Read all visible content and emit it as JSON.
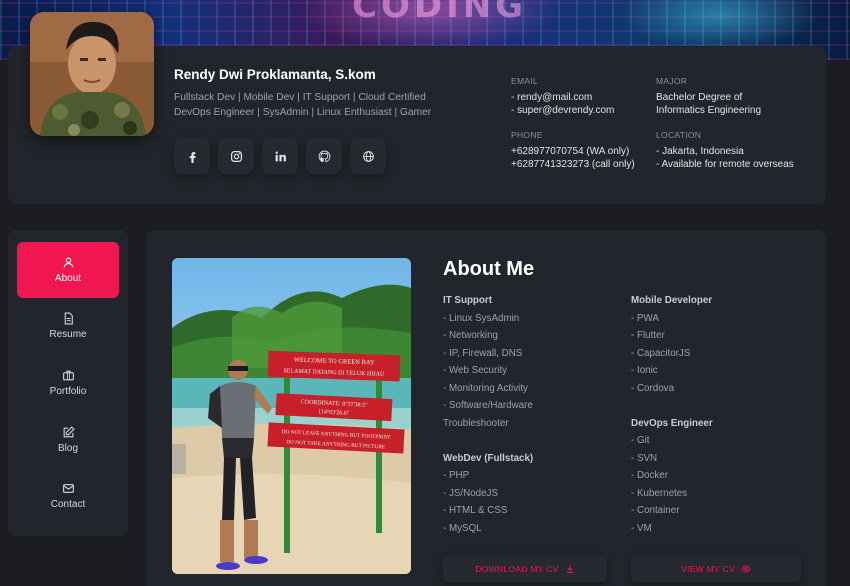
{
  "banner": {
    "text": "CODING"
  },
  "profile": {
    "name": "Rendy Dwi Proklamanta, S.kom",
    "roles_line1": "Fullstack Dev | Mobile Dev | IT Support | Cloud Certified",
    "roles_line2": "DevOps Engineer | SysAdmin | Linux Enthusiast | Gamer"
  },
  "socials": [
    {
      "name": "facebook-icon"
    },
    {
      "name": "instagram-icon"
    },
    {
      "name": "linkedin-icon"
    },
    {
      "name": "github-icon"
    },
    {
      "name": "globe-icon"
    }
  ],
  "info": {
    "email_label": "EMAIL",
    "email_1": "- rendy@mail.com",
    "email_2": "- super@devrendy.com",
    "major_label": "MAJOR",
    "major_1": "Bachelor Degree of",
    "major_2": "Informatics Engineering",
    "phone_label": "PHONE",
    "phone_1": "+628977070754 (WA only)",
    "phone_2": "+6287741323273 (call only)",
    "location_label": "LOCATION",
    "location_1": "- Jakarta, Indonesia",
    "location_2": "- Available for remote overseas"
  },
  "nav": [
    {
      "label": "About",
      "icon": "user-icon"
    },
    {
      "label": "Resume",
      "icon": "document-icon"
    },
    {
      "label": "Portfolio",
      "icon": "briefcase-icon"
    },
    {
      "label": "Blog",
      "icon": "edit-icon"
    },
    {
      "label": "Contact",
      "icon": "mail-icon"
    }
  ],
  "about": {
    "title": "About Me",
    "it_support": {
      "heading": "IT Support",
      "items": [
        "- Linux SysAdmin",
        "- Networking",
        "- IP, Firewall, DNS",
        "- Web Security",
        "- Monitoring Activity",
        "- Software/Hardware",
        "Troubleshooter"
      ]
    },
    "webdev": {
      "heading": "WebDev (Fullstack)",
      "items": [
        "- PHP",
        "- JS/NodeJS",
        "- HTML & CSS",
        "- MySQL"
      ]
    },
    "mobile": {
      "heading": "Mobile Developer",
      "items": [
        "- PWA",
        "- Flutter",
        "- CapacitorJS",
        "- Ionic",
        "- Cordova"
      ]
    },
    "devops": {
      "heading": "DevOps Engineer",
      "items": [
        "- Git",
        "- SVN",
        "- Docker",
        "- Kubernetes",
        "- Container",
        "- VM"
      ]
    },
    "download_cv": "DOWNLOAD MY CV",
    "view_cv": "VIEW MY CV"
  },
  "photo_signs": {
    "sign1_line1": "WELCOME TO GREEN BAY",
    "sign1_line2": "SELAMAT DATANG DI TELUK HIJAU",
    "sign2_line1": "COORDINATE: 8°37'38.5\"",
    "sign2_line2": "114°03'26.6\"",
    "sign3_line1": "DO NOT LEAVE ANYTHING BUT FOOTPRINT",
    "sign3_line2": "DO NOT TAKE ANYTHING BUT PICTURE"
  },
  "colors": {
    "accent": "#f0164f",
    "card": "#22252b",
    "background": "#1b1d22"
  }
}
